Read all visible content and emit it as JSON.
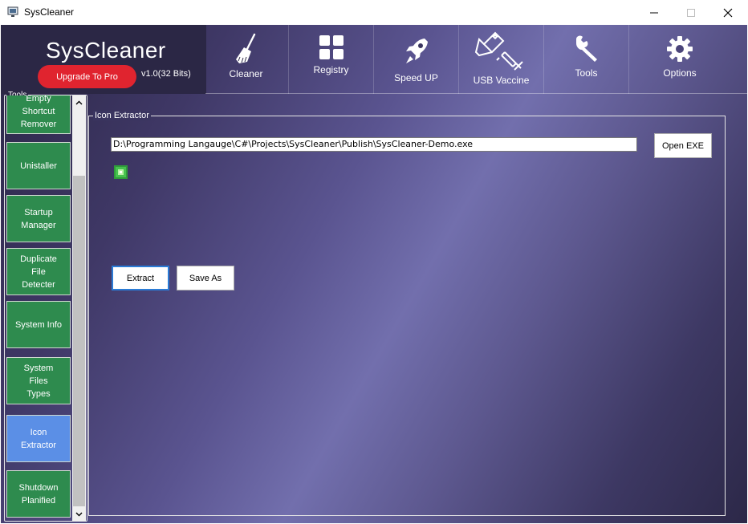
{
  "window": {
    "title": "SysCleaner",
    "app_icon": "monitor-icon",
    "controls": [
      "minimize-icon",
      "maximize-icon",
      "close-icon"
    ]
  },
  "header": {
    "brand": "SysCleaner",
    "upgrade_label": "Upgrade To Pro",
    "version": "v1.0(32 Bits)",
    "tabs": [
      {
        "label": "Cleaner",
        "icon": "broom-icon"
      },
      {
        "label": "Registry",
        "icon": "grid-icon"
      },
      {
        "label": "Speed UP",
        "icon": "rocket-icon"
      },
      {
        "label": "USB Vaccine",
        "icon": "usb-syringe-icon"
      },
      {
        "label": "Tools",
        "icon": "wrench-icon"
      },
      {
        "label": "Options",
        "icon": "gear-icon"
      }
    ]
  },
  "sidebar": {
    "group_label": "Tools",
    "items": [
      {
        "label": "Empty Shortcut Remover",
        "lines": [
          "Empty",
          "Shortcut",
          "Remover"
        ]
      },
      {
        "label": "Unistaller",
        "lines": [
          "Unistaller"
        ]
      },
      {
        "label": "Startup Manager",
        "lines": [
          "Startup",
          "Manager"
        ]
      },
      {
        "label": "Duplicate File Detecter",
        "lines": [
          "Duplicate",
          "File",
          "Detecter"
        ]
      },
      {
        "label": "System Info",
        "lines": [
          "System Info"
        ]
      },
      {
        "label": "System Files Types",
        "lines": [
          "System",
          "Files",
          "Types"
        ]
      },
      {
        "label": "Icon Extractor",
        "lines": [
          "Icon",
          "Extractor"
        ]
      },
      {
        "label": "Shutdown Planified",
        "lines": [
          "Shutdown",
          "Planified"
        ]
      }
    ],
    "active_item": "Icon Extractor"
  },
  "extractor": {
    "group_label": "Icon Extractor",
    "path_value": "D:\\Programming Langauge\\C#\\Projects\\SysCleaner\\Publish\\SysCleaner-Demo.exe",
    "open_label": "Open EXE",
    "extract_label": "Extract",
    "saveas_label": "Save As",
    "preview_icon": "extracted-app-icon"
  },
  "colors": {
    "sidebar_item": "#2e8b4e",
    "sidebar_active": "#5b8fe6",
    "upgrade": "#e0242f",
    "header_dark": "#2b2745"
  }
}
